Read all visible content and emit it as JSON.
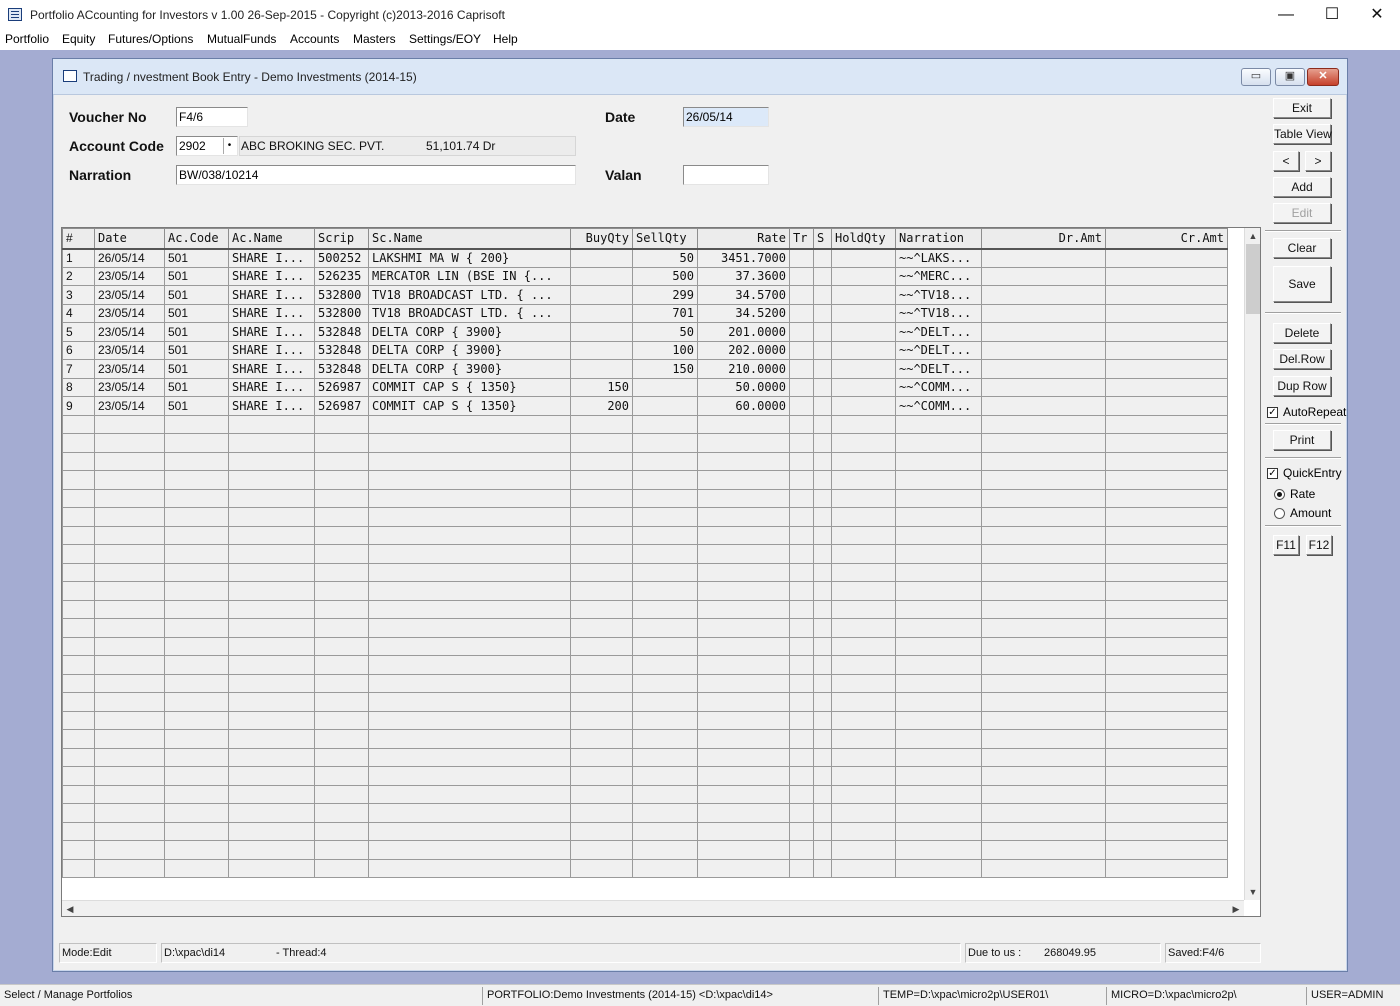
{
  "app": {
    "title": "Portfolio ACcounting for Investors   v 1.00  26-Sep-2015 - Copyright (c)2013-2016 Caprisoft",
    "minimize": "—",
    "maximize": "☐",
    "close": "✕"
  },
  "menu": [
    "Portfolio",
    "Equity",
    "Futures/Options",
    "MutualFunds",
    "Accounts",
    "Masters",
    "Settings/EOY",
    "Help"
  ],
  "child": {
    "title": "Trading / nvestment Book Entry - Demo Investments (2014-15)",
    "btn_min": "▭",
    "btn_max": "▣",
    "btn_close": "✕"
  },
  "form": {
    "voucher_label": "Voucher No",
    "voucher_value": "F4/6",
    "date_label": "Date",
    "date_value": "26/05/14",
    "account_label": "Account Code",
    "account_code": "2902",
    "account_name": "ABC BROKING SEC. PVT.",
    "account_balance": "51,101.74 Dr",
    "narration_label": "Narration",
    "narration_value": "BW/038/10214",
    "valan_label": "Valan",
    "valan_value": ""
  },
  "grid": {
    "columns": [
      "#",
      "Date",
      "Ac.Code",
      "Ac.Name",
      "Scrip",
      "Sc.Name",
      "BuyQty",
      "SellQty",
      "Rate",
      "Tr",
      "S",
      "HoldQty",
      "Narration",
      "Dr.Amt",
      "Cr.Amt"
    ],
    "rows": [
      [
        "1",
        "26/05/14",
        "501",
        "SHARE I...",
        "500252",
        "LAKSHMI MA W {       200}",
        "",
        "50",
        "3451.7000",
        "",
        "",
        "",
        "~~^LAKS...",
        "",
        ""
      ],
      [
        "2",
        "23/05/14",
        "501",
        "SHARE I...",
        "526235",
        "MERCATOR LIN (BSE IN {...",
        "",
        "500",
        "37.3600",
        "",
        "",
        "",
        "~~^MERC...",
        "",
        ""
      ],
      [
        "3",
        "23/05/14",
        "501",
        "SHARE I...",
        "532800",
        "TV18 BROADCAST LTD. { ...",
        "",
        "299",
        "34.5700",
        "",
        "",
        "",
        "~~^TV18...",
        "",
        ""
      ],
      [
        "4",
        "23/05/14",
        "501",
        "SHARE I...",
        "532800",
        "TV18 BROADCAST LTD. { ...",
        "",
        "701",
        "34.5200",
        "",
        "",
        "",
        "~~^TV18...",
        "",
        ""
      ],
      [
        "5",
        "23/05/14",
        "501",
        "SHARE I...",
        "532848",
        "DELTA CORP {      3900}",
        "",
        "50",
        "201.0000",
        "",
        "",
        "",
        "~~^DELT...",
        "",
        ""
      ],
      [
        "6",
        "23/05/14",
        "501",
        "SHARE I...",
        "532848",
        "DELTA CORP {      3900}",
        "",
        "100",
        "202.0000",
        "",
        "",
        "",
        "~~^DELT...",
        "",
        ""
      ],
      [
        "7",
        "23/05/14",
        "501",
        "SHARE I...",
        "532848",
        "DELTA CORP {      3900}",
        "",
        "150",
        "210.0000",
        "",
        "",
        "",
        "~~^DELT...",
        "",
        ""
      ],
      [
        "8",
        "23/05/14",
        "501",
        "SHARE I...",
        "526987",
        "COMMIT CAP S {      1350}",
        "150",
        "",
        "50.0000",
        "",
        "",
        "",
        "~~^COMM...",
        "",
        ""
      ],
      [
        "9",
        "23/05/14",
        "501",
        "SHARE I...",
        "526987",
        "COMMIT CAP S {      1350}",
        "200",
        "",
        "60.0000",
        "",
        "",
        "",
        "~~^COMM...",
        "",
        ""
      ]
    ]
  },
  "side": {
    "exit": "Exit",
    "table_view": "Table View",
    "prev": "<",
    "next": ">",
    "add": "Add",
    "edit": "Edit",
    "clear": "Clear",
    "save": "Save",
    "delete": "Delete",
    "del_row": "Del.Row",
    "dup_row": "Dup Row",
    "auto_repeat": "AutoRepeat",
    "print": "Print",
    "quick_entry": "QuickEntry",
    "rate": "Rate",
    "amount": "Amount",
    "f11": "F11",
    "f12": "F12"
  },
  "child_status": {
    "mode": "Mode:Edit",
    "path": "D:\\xpac\\di14",
    "thread": "- Thread:4",
    "due_label": "Due to us :",
    "due_value": "268049.95",
    "saved": "Saved:F4/6"
  },
  "statusbar": {
    "hint": "Select / Manage Portfolios",
    "portfolio": "PORTFOLIO:Demo Investments (2014-15)  <D:\\xpac\\di14>",
    "temp": "TEMP=D:\\xpac\\micro2p\\USER01\\",
    "micro": "MICRO=D:\\xpac\\micro2p\\",
    "user": "USER=ADMIN"
  }
}
